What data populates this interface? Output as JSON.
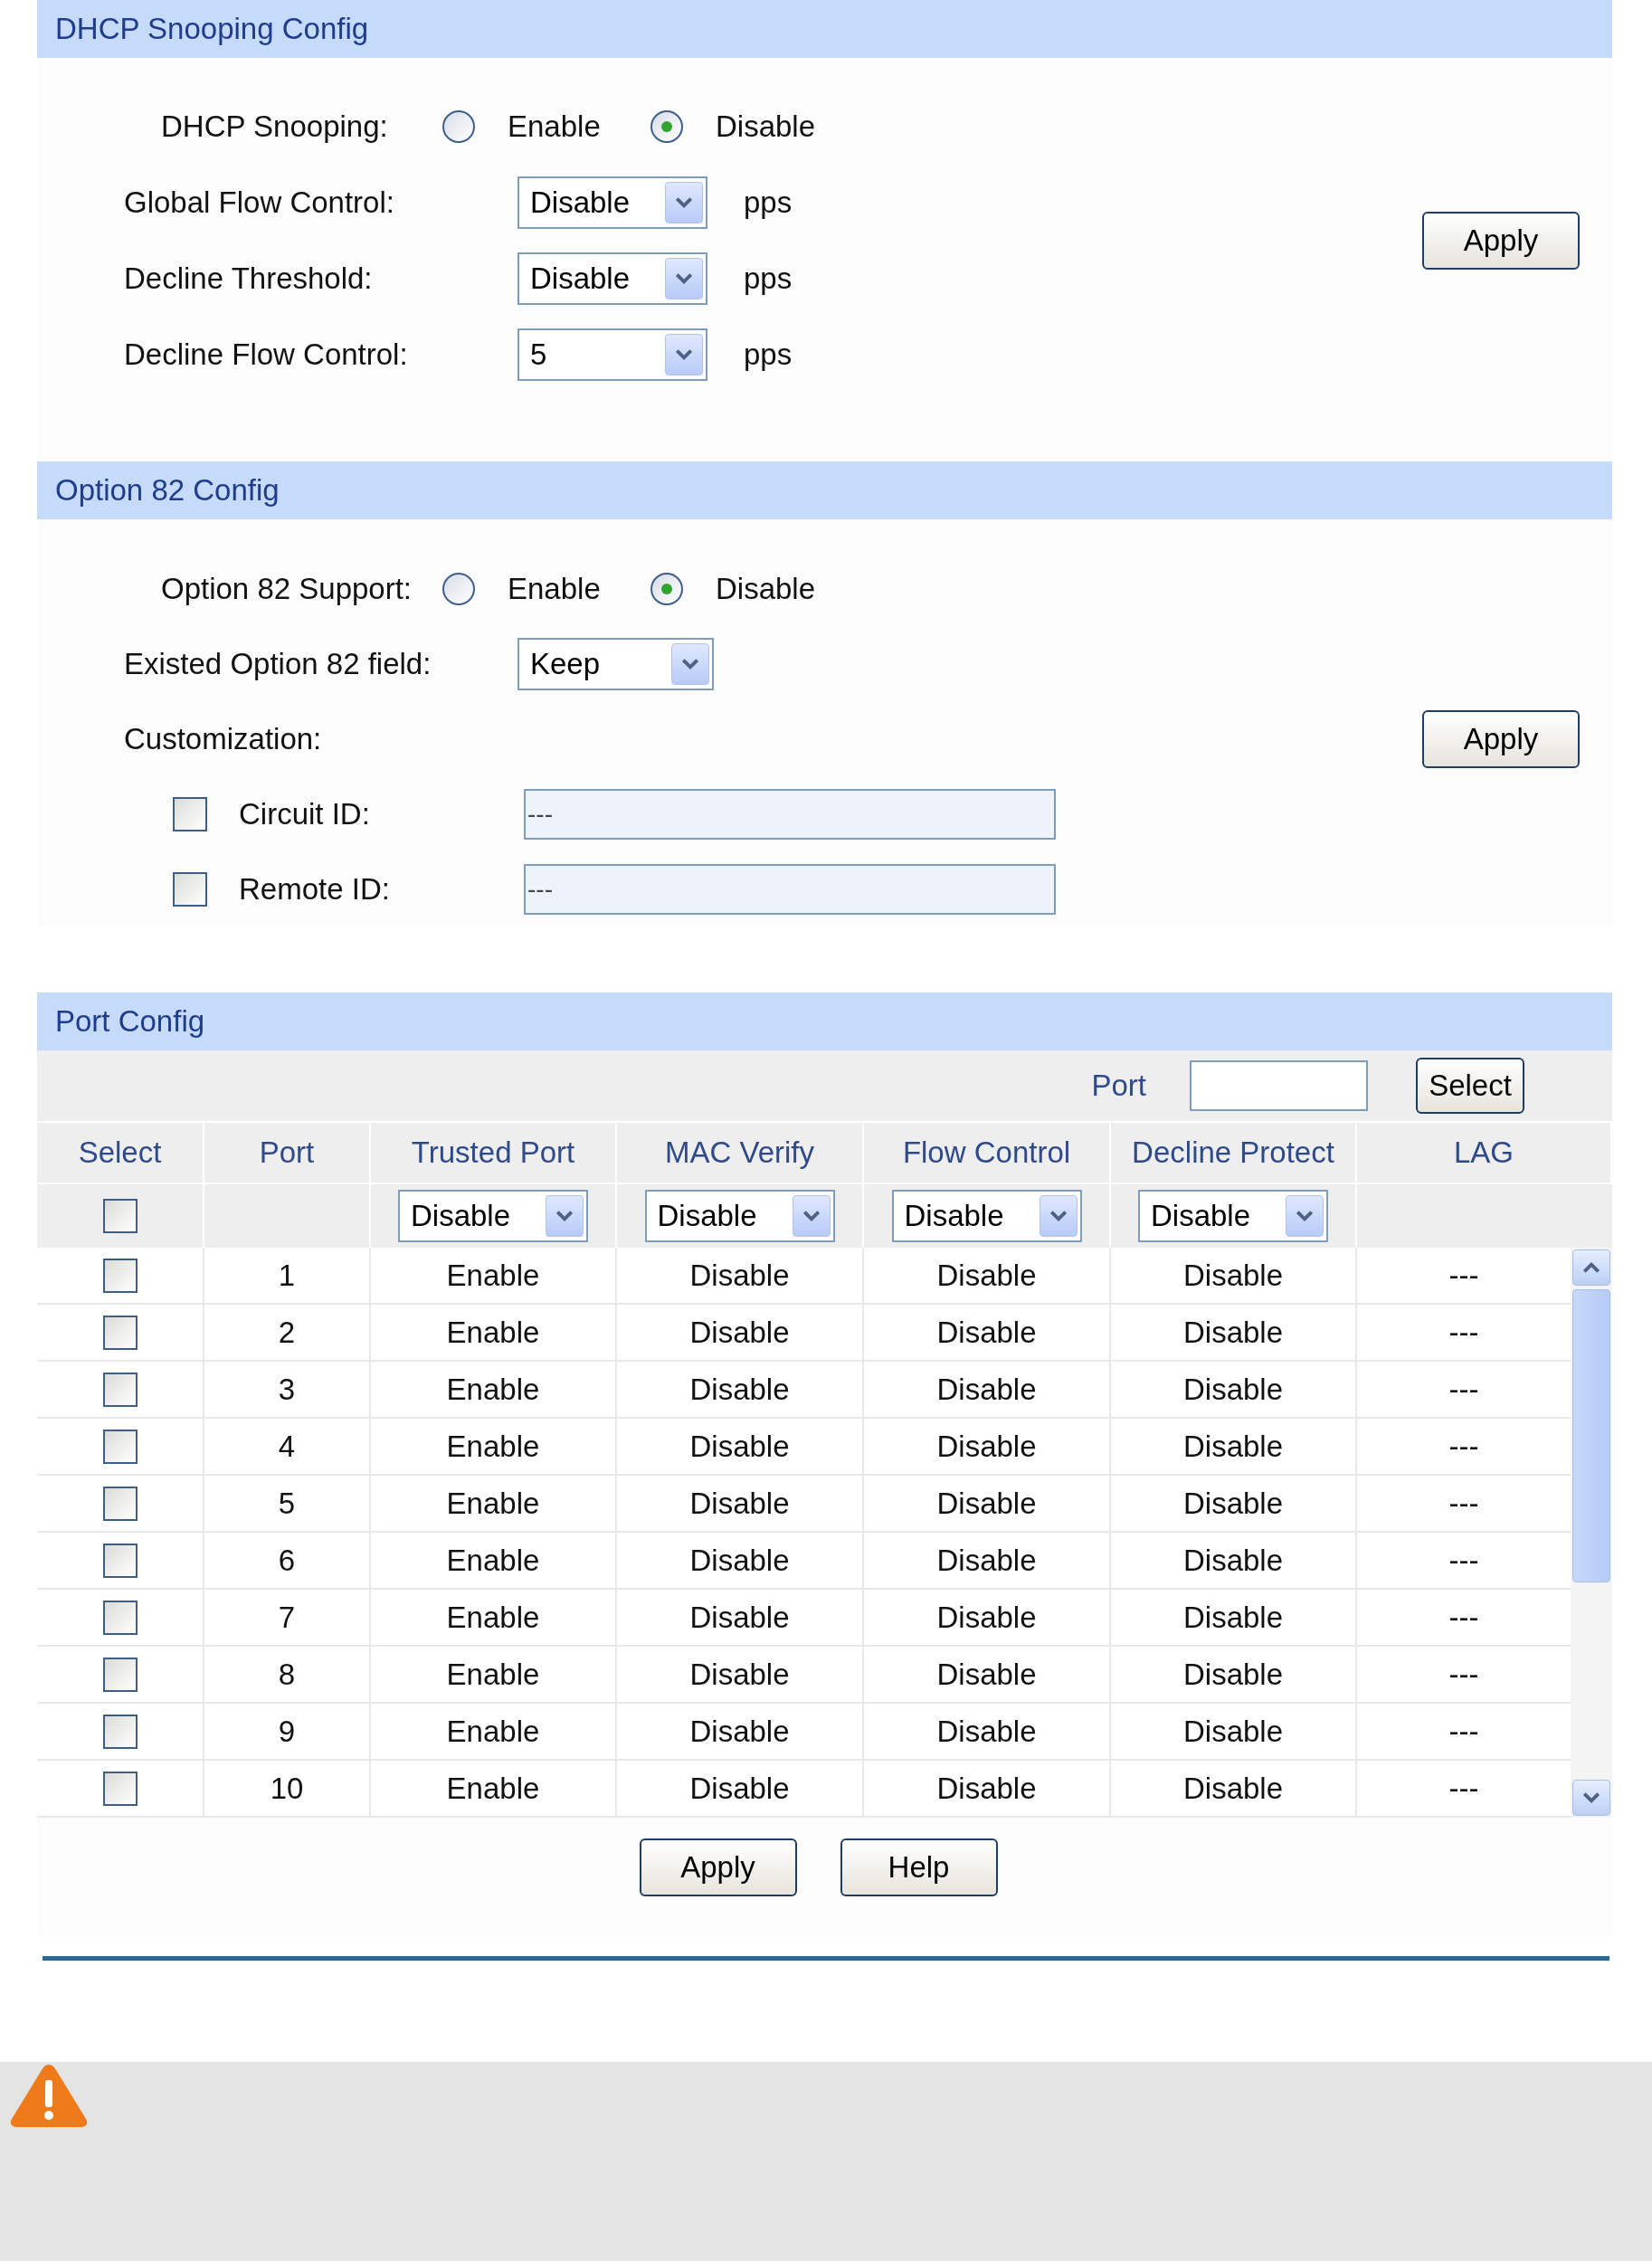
{
  "dhcp_snooping_config": {
    "title": "DHCP Snooping Config",
    "fields": [
      {
        "kind": "radio",
        "label": "DHCP Snooping:",
        "options": [
          {
            "label": "Enable",
            "selected": false
          },
          {
            "label": "Disable",
            "selected": true
          }
        ]
      },
      {
        "kind": "select",
        "label": "Global Flow Control:",
        "value": "Disable",
        "unit": "pps"
      },
      {
        "kind": "select",
        "label": "Decline Threshold:",
        "value": "Disable",
        "unit": "pps"
      },
      {
        "kind": "select",
        "label": "Decline Flow Control:",
        "value": "5",
        "unit": "pps"
      }
    ],
    "apply": "Apply"
  },
  "option82_config": {
    "title": "Option 82 Config",
    "fields": [
      {
        "kind": "radio",
        "label": "Option 82 Support:",
        "options": [
          {
            "label": "Enable",
            "selected": false
          },
          {
            "label": "Disable",
            "selected": true
          }
        ]
      },
      {
        "kind": "select",
        "label": "Existed Option 82 field:",
        "value": "Keep"
      },
      {
        "kind": "heading",
        "label": "Customization:"
      },
      {
        "kind": "checkbox_text",
        "label": "Circuit ID:",
        "checked": false,
        "value": "---"
      },
      {
        "kind": "checkbox_text",
        "label": "Remote ID:",
        "checked": false,
        "value": "---"
      }
    ],
    "apply": "Apply"
  },
  "port_config": {
    "title": "Port Config",
    "filter": {
      "label": "Port",
      "button": "Select"
    },
    "columns": [
      "Select",
      "Port",
      "Trusted Port",
      "MAC Verify",
      "Flow Control",
      "Decline Protect",
      "LAG"
    ],
    "bulk_row": {
      "checked": false,
      "selects": [
        "Disable",
        "Disable",
        "Disable",
        "Disable"
      ]
    },
    "rows": [
      {
        "checked": false,
        "port": "1",
        "trusted_port": "Enable",
        "mac_verify": "Disable",
        "flow_control": "Disable",
        "decline_protect": "Disable",
        "lag": "---"
      },
      {
        "checked": false,
        "port": "2",
        "trusted_port": "Enable",
        "mac_verify": "Disable",
        "flow_control": "Disable",
        "decline_protect": "Disable",
        "lag": "---"
      },
      {
        "checked": false,
        "port": "3",
        "trusted_port": "Enable",
        "mac_verify": "Disable",
        "flow_control": "Disable",
        "decline_protect": "Disable",
        "lag": "---"
      },
      {
        "checked": false,
        "port": "4",
        "trusted_port": "Enable",
        "mac_verify": "Disable",
        "flow_control": "Disable",
        "decline_protect": "Disable",
        "lag": "---"
      },
      {
        "checked": false,
        "port": "5",
        "trusted_port": "Enable",
        "mac_verify": "Disable",
        "flow_control": "Disable",
        "decline_protect": "Disable",
        "lag": "---"
      },
      {
        "checked": false,
        "port": "6",
        "trusted_port": "Enable",
        "mac_verify": "Disable",
        "flow_control": "Disable",
        "decline_protect": "Disable",
        "lag": "---"
      },
      {
        "checked": false,
        "port": "7",
        "trusted_port": "Enable",
        "mac_verify": "Disable",
        "flow_control": "Disable",
        "decline_protect": "Disable",
        "lag": "---"
      },
      {
        "checked": false,
        "port": "8",
        "trusted_port": "Enable",
        "mac_verify": "Disable",
        "flow_control": "Disable",
        "decline_protect": "Disable",
        "lag": "---"
      },
      {
        "checked": false,
        "port": "9",
        "trusted_port": "Enable",
        "mac_verify": "Disable",
        "flow_control": "Disable",
        "decline_protect": "Disable",
        "lag": "---"
      },
      {
        "checked": false,
        "port": "10",
        "trusted_port": "Enable",
        "mac_verify": "Disable",
        "flow_control": "Disable",
        "decline_protect": "Disable",
        "lag": "---"
      }
    ],
    "buttons": [
      "Apply",
      "Help"
    ]
  }
}
